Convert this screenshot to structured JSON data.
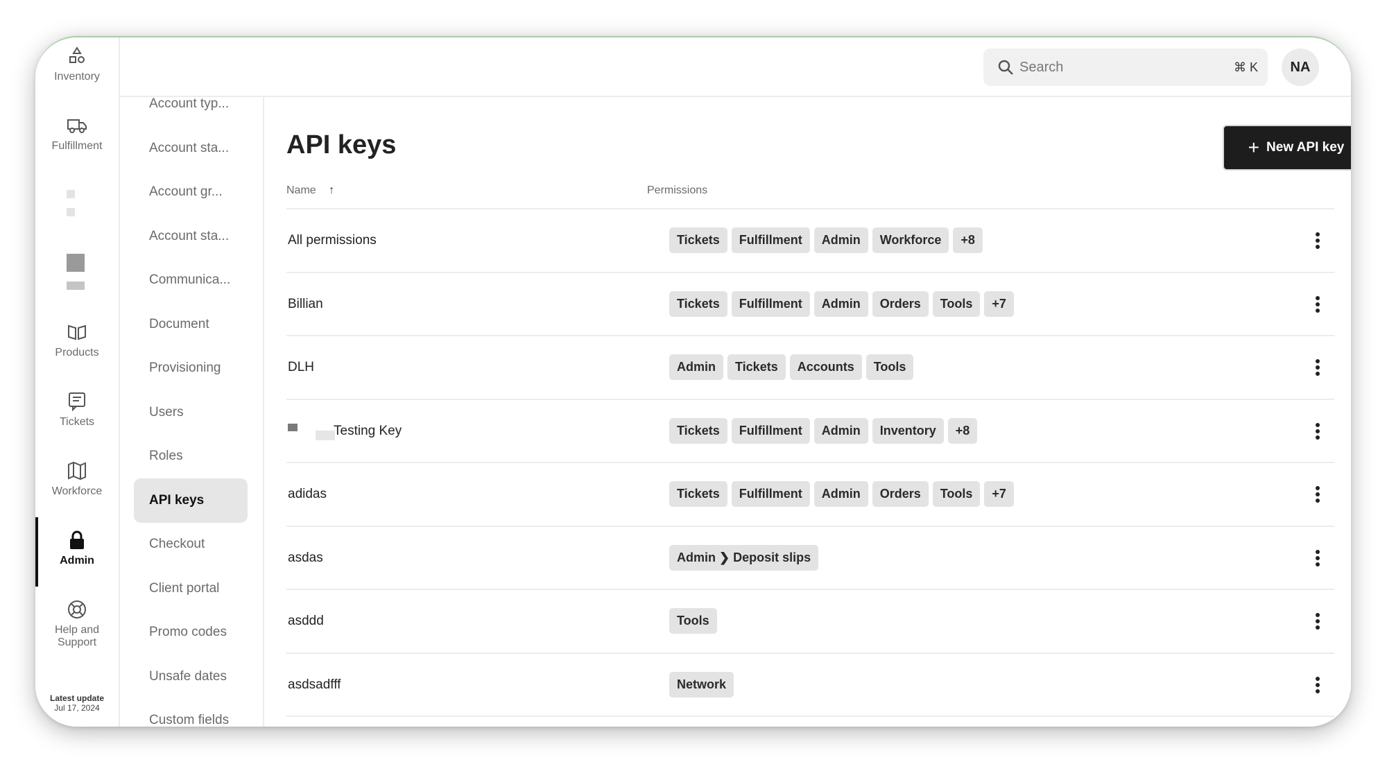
{
  "rail": {
    "items": [
      {
        "label": "Inventory",
        "icon": "shapes-icon"
      },
      {
        "label": "Fulfillment",
        "icon": "truck-icon"
      },
      {
        "label": "Products",
        "icon": "book-open-icon"
      },
      {
        "label": "Tickets",
        "icon": "ticket-list-icon"
      },
      {
        "label": "Workforce",
        "icon": "map-icon"
      },
      {
        "label": "Admin",
        "icon": "lock-icon"
      },
      {
        "label_line1": "Help and",
        "label_line2": "Support",
        "icon": "lifebuoy-icon"
      }
    ],
    "footer": {
      "title": "Latest update",
      "date": "Jul 17, 2024"
    }
  },
  "topbar": {
    "search_placeholder": "Search",
    "search_shortcut": "⌘ K",
    "avatar_initials": "NA"
  },
  "subnav": {
    "items": [
      "Account typ...",
      "Account sta...",
      "Account gr...",
      "Account sta...",
      "Communica...",
      "Document",
      "Provisioning",
      "Users",
      "Roles",
      "API keys",
      "Checkout",
      "Client portal",
      "Promo codes",
      "Unsafe dates",
      "Custom fields"
    ],
    "active": "API keys"
  },
  "page": {
    "title": "API keys",
    "new_button": "New API key"
  },
  "table": {
    "columns": {
      "name": "Name",
      "name_sort": "↑",
      "permissions": "Permissions"
    },
    "rows": [
      {
        "name": "All permissions",
        "permissions": [
          "Tickets",
          "Fulfillment",
          "Admin",
          "Workforce",
          "+8"
        ]
      },
      {
        "name": "Billian",
        "permissions": [
          "Tickets",
          "Fulfillment",
          "Admin",
          "Orders",
          "Tools",
          "+7"
        ]
      },
      {
        "name": "DLH",
        "permissions": [
          "Admin",
          "Tickets",
          "Accounts",
          "Tools"
        ]
      },
      {
        "name": "Testing Key",
        "permissions": [
          "Tickets",
          "Fulfillment",
          "Admin",
          "Inventory",
          "+8"
        ]
      },
      {
        "name": "adidas",
        "permissions": [
          "Tickets",
          "Fulfillment",
          "Admin",
          "Orders",
          "Tools",
          "+7"
        ]
      },
      {
        "name": "asdas",
        "permissions": [
          "Admin ❯ Deposit slips"
        ]
      },
      {
        "name": "asddd",
        "permissions": [
          "Tools"
        ]
      },
      {
        "name": "asdsadfff",
        "permissions": [
          "Network"
        ]
      }
    ]
  },
  "colors": {
    "accent": "#1d1d1d",
    "chip_bg": "#e3e3e3",
    "frame_top": "#a9cfa6"
  }
}
